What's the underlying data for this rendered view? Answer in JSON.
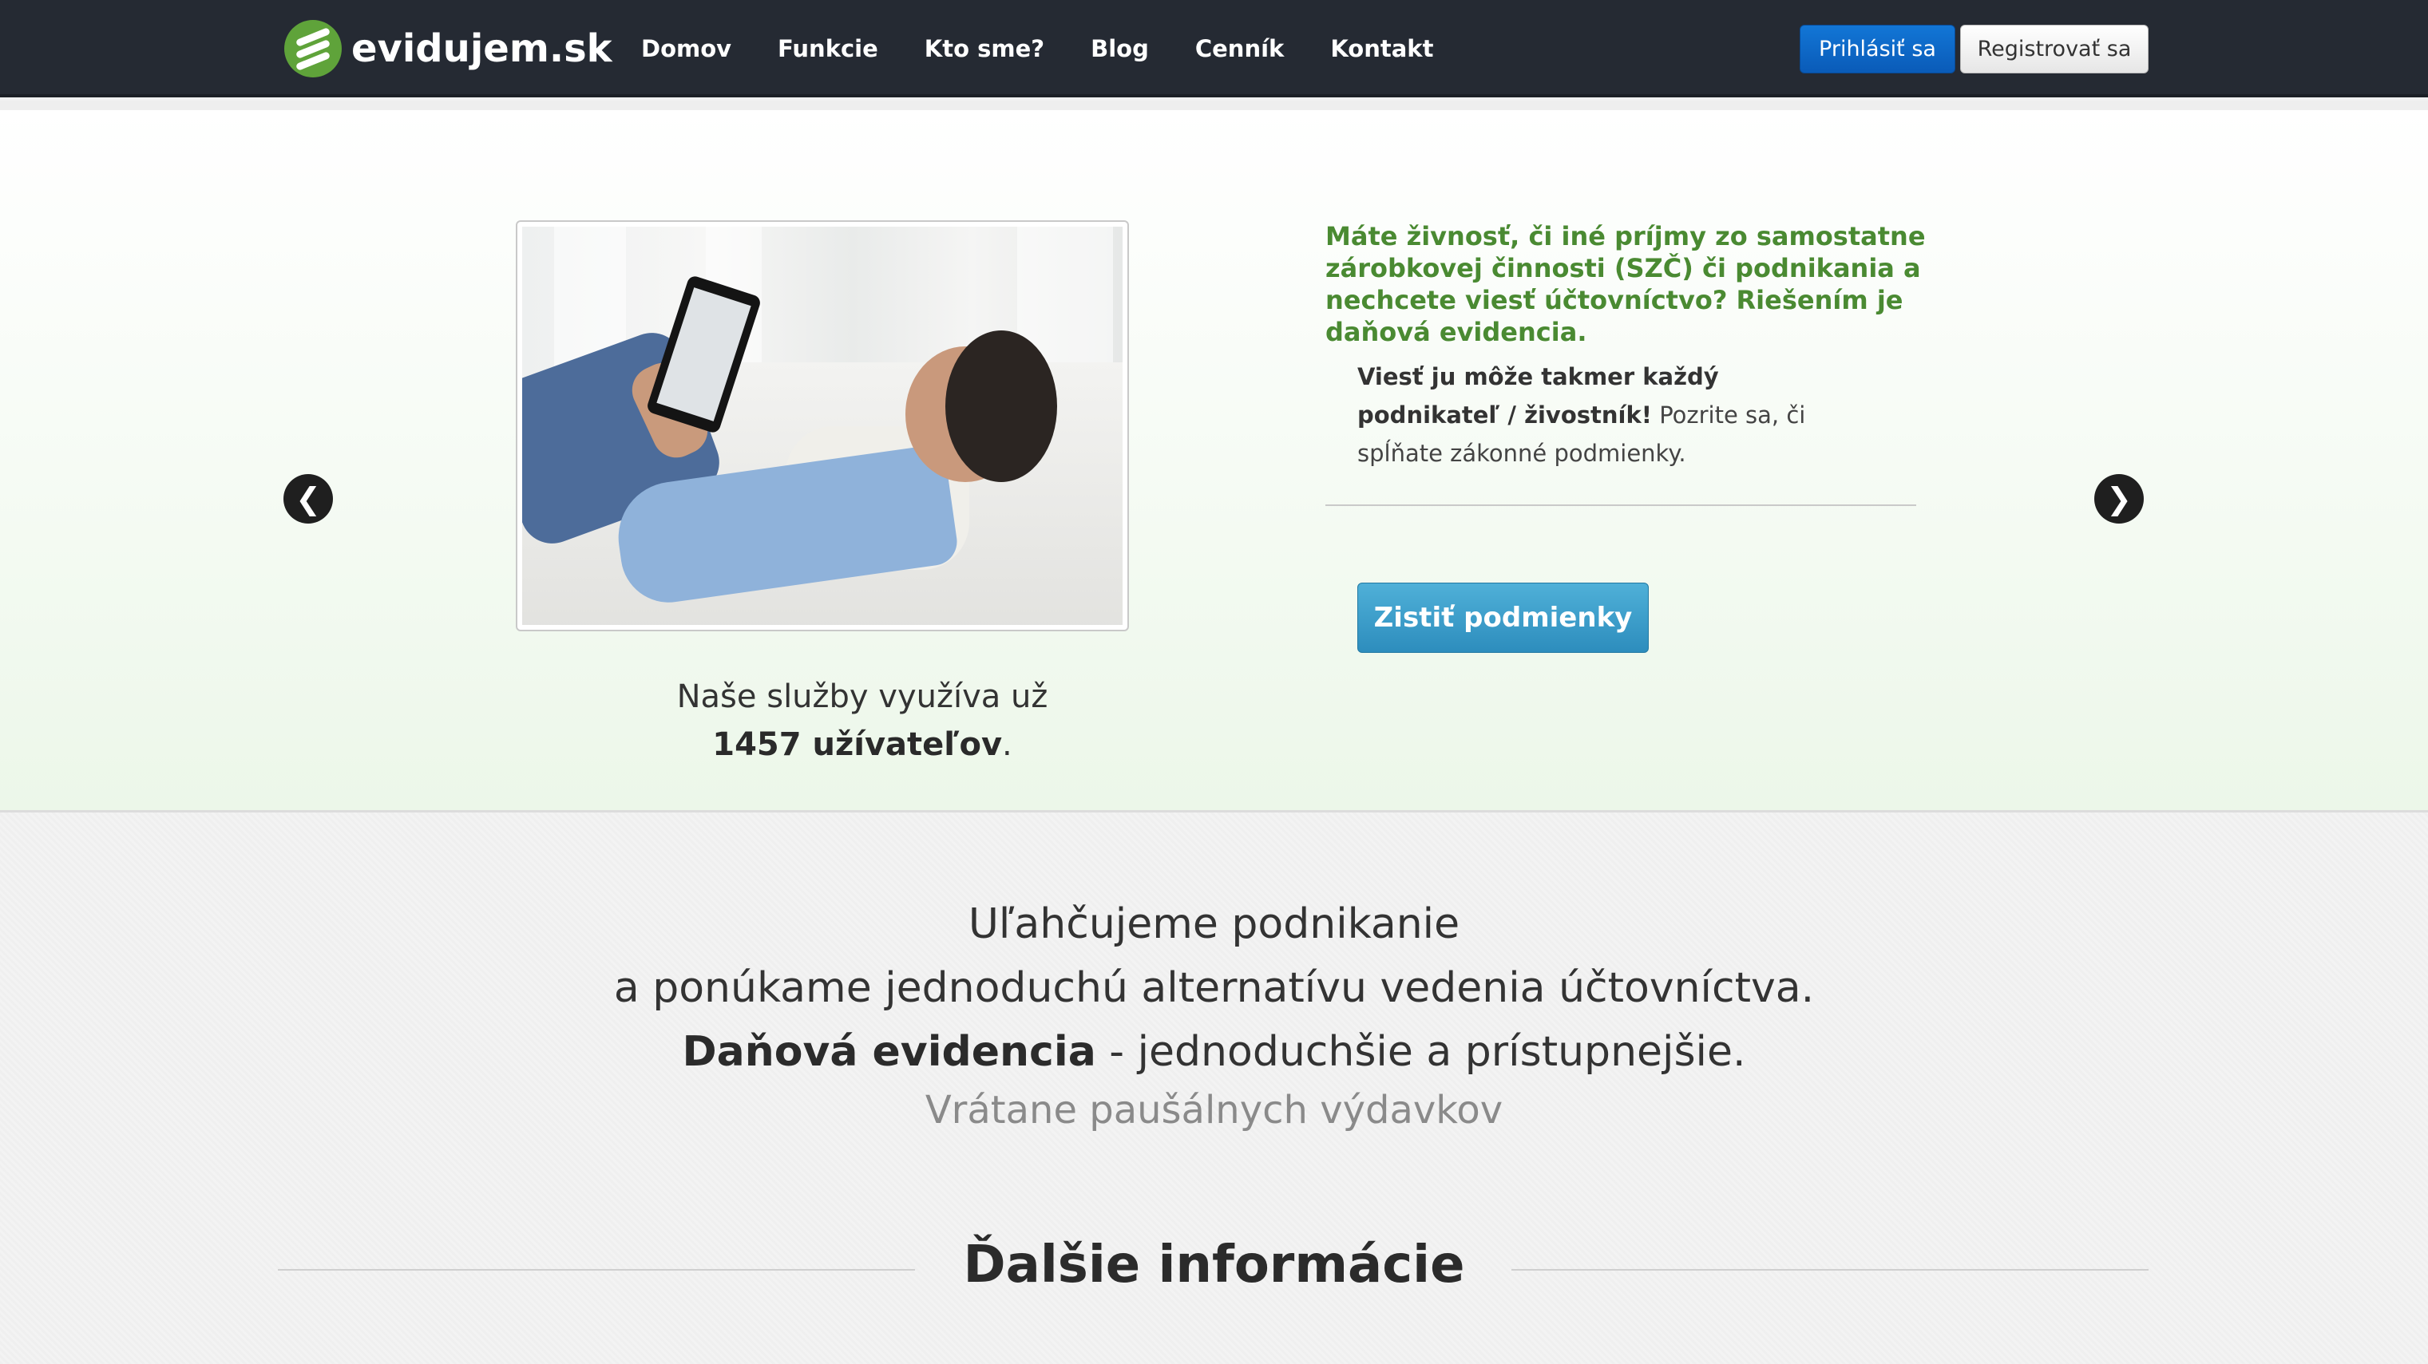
{
  "header": {
    "logo_text": "evidujem.sk",
    "nav": [
      "Domov",
      "Funkcie",
      "Kto sme?",
      "Blog",
      "Cenník",
      "Kontakt"
    ],
    "login_label": "Prihlásiť sa",
    "register_label": "Registrovať sa"
  },
  "hero": {
    "prev_arrow": "❮",
    "next_arrow": "❯",
    "caption_line1": "Naše služby využíva už",
    "caption_count": "1457 užívateľov",
    "caption_end": ".",
    "lead": "Máte živnosť, či iné príjmy zo samostatne zárobkovej činnosti (SZČ) či podnikania a nechcete viesť účtovníctvo? Riešením je daňová evidencia.",
    "sub_bold": "Viesť ju môže takmer každý podnikateľ / živostník!",
    "sub_rest": " Pozrite sa, či spĺňate zákonné podmienky.",
    "cta_label": "Zistiť podmienky"
  },
  "intro": {
    "line1": "Uľahčujeme podnikanie",
    "line2": "a ponúkame jednoduchú alternatívu vedenia účtovníctva.",
    "line3_bold": "Daňová evidencia",
    "line3_rest": " - jednoduchšie a prístupnejšie.",
    "subtitle": "Vrátane paušálnych výdavkov"
  },
  "more_info": {
    "title": "Ďalšie informácie"
  },
  "colors": {
    "navbar_bg": "#252a33",
    "brand_green": "#5fa33a",
    "login_blue": "#0a5bb8",
    "cta_blue": "#3a9bc9"
  }
}
